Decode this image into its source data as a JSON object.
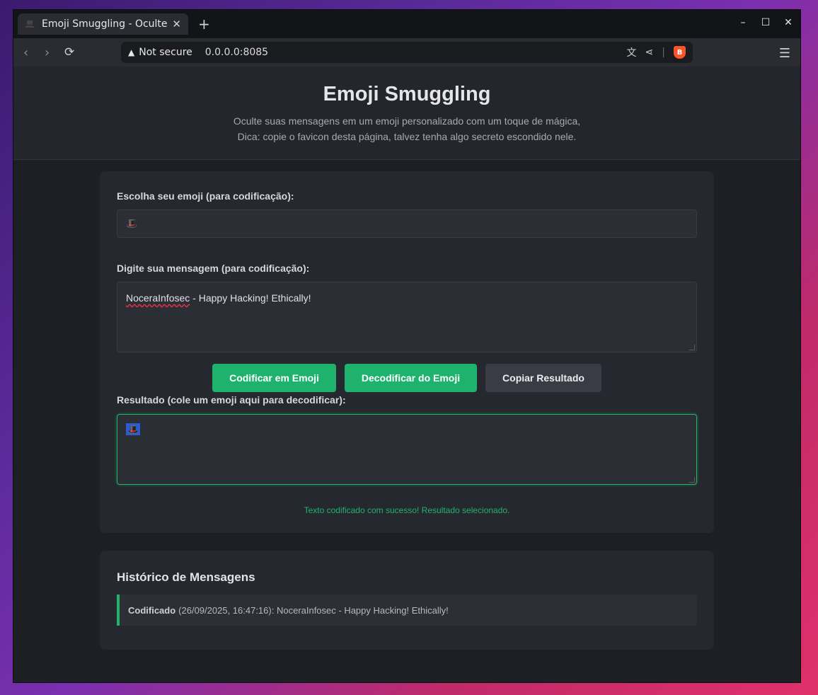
{
  "browser": {
    "tab_title": "Emoji Smuggling - Oculte",
    "tab_close": "✕",
    "new_tab": "+",
    "not_secure": "Not secure",
    "url": "0.0.0.0:8085",
    "window_controls": [
      "–",
      "☐",
      "✕"
    ]
  },
  "header": {
    "title": "Emoji Smuggling",
    "subtitle_line1": "Oculte suas mensagens em um emoji personalizado com um toque de mágica,",
    "subtitle_line2": "Dica: copie o favicon desta página, talvez tenha algo secreto escondido nele."
  },
  "form": {
    "emoji_label": "Escolha seu emoji (para codificação):",
    "emoji_value": "🎩",
    "message_label": "Digite sua mensagem (para codificação):",
    "message_value_word": "NoceraInfosec",
    "message_value_rest": " - Happy Hacking! Ethically!",
    "encode_button": "Codificar em Emoji",
    "decode_button": "Decodificar do Emoji",
    "copy_button": "Copiar Resultado",
    "result_label": "Resultado (cole um emoji aqui para decodificar):",
    "result_value": "🎩",
    "status": "Texto codificado com sucesso! Resultado selecionado."
  },
  "history": {
    "title": "Histórico de Mensagens",
    "items": [
      {
        "type": "Codificado",
        "detail": "(26/09/2025, 16:47:16): NoceraInfosec - Happy Hacking! Ethically!"
      }
    ]
  },
  "colors": {
    "accent": "#1fb26d",
    "brave": "#fb542b"
  }
}
